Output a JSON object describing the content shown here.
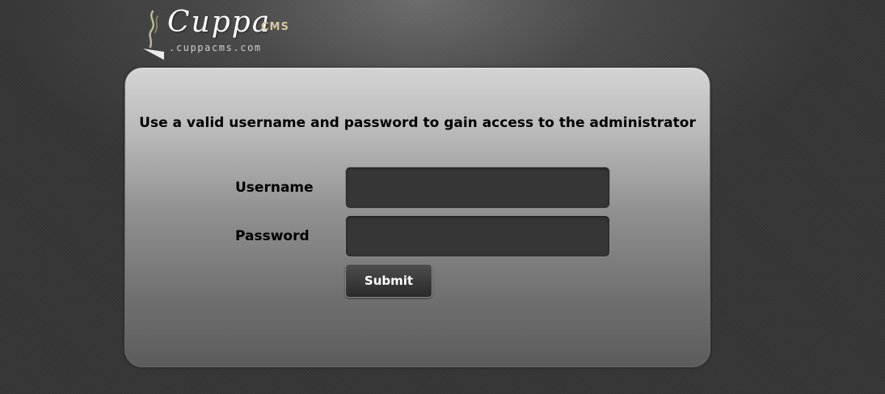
{
  "logo": {
    "word": "Cuppa",
    "suffix": "CMS",
    "url": ".cuppacms.com",
    "icon": "coffee-steam-icon"
  },
  "login": {
    "instructions": "Use a valid username and password to gain access to the administrator",
    "username_label": "Username",
    "username_value": "",
    "password_label": "Password",
    "password_value": "",
    "submit_label": "Submit"
  },
  "colors": {
    "background": "#3d3d3d",
    "input_background": "#363636",
    "logo_accent": "#d8c79a"
  }
}
